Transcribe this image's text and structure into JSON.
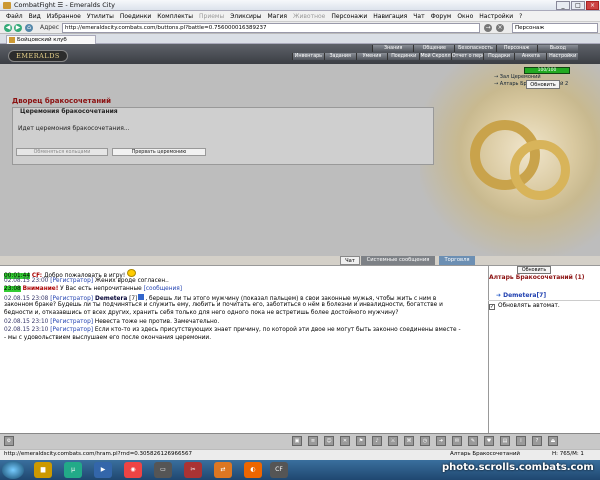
{
  "window": {
    "title": "CombatFight ☰ - Emeralds City"
  },
  "menu": [
    "Файл",
    "Вид",
    "Избранное",
    "Утилиты",
    "Поединки",
    "Комплекты",
    "Приемы",
    "Эликсиры",
    "Магия",
    "Животное",
    "Персонажи",
    "Навигация",
    "Чат",
    "Форум",
    "Окно",
    "Настройки",
    "?"
  ],
  "address": {
    "label": "Адрес",
    "url": "http://emeraldscity.combats.com/buttons.pl?battle=0.756000016389237",
    "search_placeholder": "Персонаж"
  },
  "tab": {
    "label": "Бойцовский клуб"
  },
  "game": {
    "logo": "EMERALDS",
    "nav_top": [
      "Знания",
      "Общение",
      "Безопасность",
      "Персонаж",
      "Выход"
    ],
    "nav_bottom": [
      "Инвентарь",
      "Задания",
      "Умения",
      "Поединки",
      "Мой Скролл",
      "Отчет о переводах",
      "Подарки",
      "Анкета",
      "Настройки"
    ],
    "status_badge": "100/100",
    "side_links": [
      "Зал Церемоний",
      "Алтарь Бракосочетаний 2"
    ],
    "refresh_label": "Обновить",
    "palace_title": "Дворец бракосочетаний",
    "fieldset_legend": "Церемония бракосочетания",
    "ceremony_status": "Идет церемония бракосочетания...",
    "btn_exchange": "Обменяться кольцами",
    "btn_interrupt": "Прервать церемонию"
  },
  "chat_tabs": [
    "Чат",
    "Системные сообщения",
    "Торговля"
  ],
  "chat": {
    "l1_ts": "00:01:44",
    "l1_a": "CF:",
    "l1_b": " Добро пожаловать в игру!",
    "l2_ts": "02.08.15 23:00",
    "l2_reg": "[Регистратор]",
    "l2_msg": " Жених вроде согласен..",
    "l3_ts": "23:08",
    "l3_sys": "Внимание!",
    "l3_msg": " У Вас есть непрочитанные ",
    "l3_link": "[сообщения]",
    "l4_ts": "02.08.15 23:08",
    "l4_reg": "[Регистратор]",
    "l4_name": " Demetera",
    "l4_lvl": " [7]",
    "l4_msg": ", берешь ли ты этого мужчину (показал пальцем) в свои законные мужья, чтобы жить с ним в",
    "l5": "законном браке? Будешь ли ты подчиняться и служить ему, любить и почитать его, заботиться о нём в болезни и инвалидности, богатстве и",
    "l6": "бедности и, отказавшись от всех других, хранить себя только для него одного пока не встретишь более достойного мужчину?",
    "l7_ts": "02.08.15 23:10",
    "l7_reg": "[Регистратор]",
    "l7_msg": " Невеста тоже не против. Замечательно.",
    "l8_ts": "02.08.15 23:10",
    "l8_reg": "[Регистратор]",
    "l8_msg": " Если кто-то из здесь присутствующих знает причину, по которой эти двое не могут быть законно соединены вместе -",
    "l9": "- мы с удовольствием выслушаем его после окончания церемонии."
  },
  "right_panel": {
    "refresh_label": "Обновить",
    "title": "Алтарь Бракосочетаний (1)",
    "user": "Demetera[7]",
    "auto_refresh_label": "Обновлять автомат."
  },
  "status": {
    "url": "http://emeraldscity.combats.com/hram.pl?rnd=0.305826126966567",
    "location": "Алтарь Бракосочетаний",
    "hp": "H: 765/M: 1"
  },
  "taskbar": {
    "watermark": "photo.scrolls.combats.com"
  }
}
